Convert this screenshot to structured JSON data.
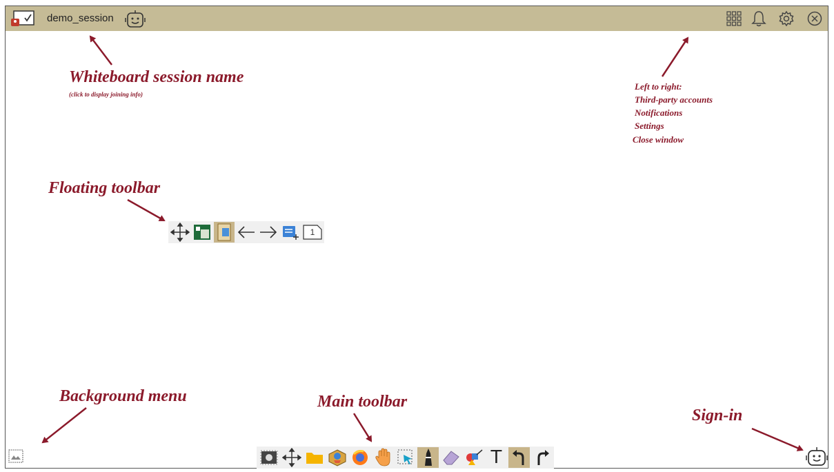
{
  "topbar": {
    "session_name": "demo_session",
    "icons": [
      "whiteboard-logo-icon",
      "robot-face-icon",
      "apps-grid-icon",
      "bell-icon",
      "gear-icon",
      "close-circle-icon"
    ]
  },
  "annotations": {
    "session_title": "Whiteboard session name",
    "session_sub": "(click to display joining info)",
    "right_line1": "Left to right:",
    "right_line2": "Third-party accounts",
    "right_line3": "Notifications",
    "right_line4": "Settings",
    "right_line5": "Close window",
    "floating_toolbar": "Floating toolbar",
    "background_menu": "Background menu",
    "main_toolbar": "Main toolbar",
    "sign_in": "Sign-in"
  },
  "floating_toolbar": {
    "items": [
      "move-icon",
      "picture-in-picture-icon",
      "page-view-icon",
      "arrow-left-icon",
      "arrow-right-icon",
      "add-page-icon",
      "page-number-icon"
    ],
    "page_number": "1"
  },
  "main_toolbar": {
    "items": [
      "screenshot-icon",
      "move-icon",
      "folder-icon",
      "resources-box-icon",
      "browser-icon",
      "hand-pan-icon",
      "select-icon",
      "pen-icon",
      "eraser-icon",
      "shapes-icon",
      "text-icon",
      "undo-icon",
      "redo-icon"
    ],
    "text_glyph": "T"
  },
  "colors": {
    "topbar": "#c5bb96",
    "annotation": "#8b1a2b",
    "active_button": "#c8b58a"
  }
}
